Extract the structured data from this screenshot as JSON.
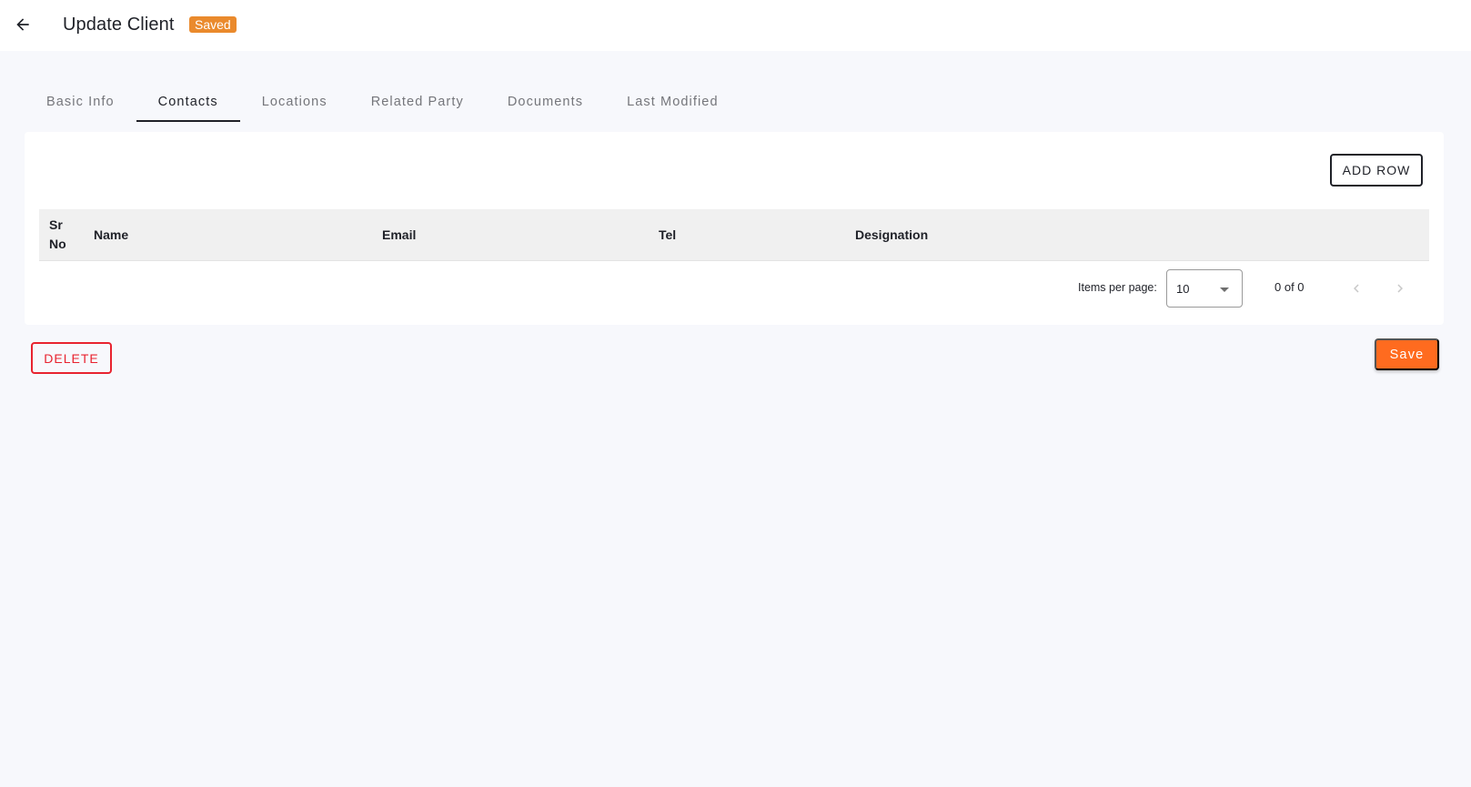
{
  "header": {
    "back_icon": "arrow-left-icon",
    "title": "Update Client",
    "status_badge": "Saved"
  },
  "tabs": [
    {
      "label": "Basic Info",
      "active": false
    },
    {
      "label": "Contacts",
      "active": true
    },
    {
      "label": "Locations",
      "active": false
    },
    {
      "label": "Related Party",
      "active": false
    },
    {
      "label": "Documents",
      "active": false
    },
    {
      "label": "Last Modified",
      "active": false
    }
  ],
  "contacts": {
    "add_row_label": "ADD ROW",
    "columns": {
      "sr_no": "Sr No",
      "name": "Name",
      "email": "Email",
      "tel": "Tel",
      "designation": "Designation"
    },
    "rows": [],
    "paginator": {
      "items_per_page_label": "Items per page:",
      "items_per_page_value": "10",
      "range_label": "0 of 0",
      "prev_icon": "chevron-left-icon",
      "next_icon": "chevron-right-icon"
    }
  },
  "actions": {
    "delete_label": "DELETE",
    "save_label": "Save"
  },
  "colors": {
    "badge": "#ea8a2c",
    "save": "#ff6b1f",
    "delete": "#e8232f",
    "background": "#f7f8fc"
  }
}
